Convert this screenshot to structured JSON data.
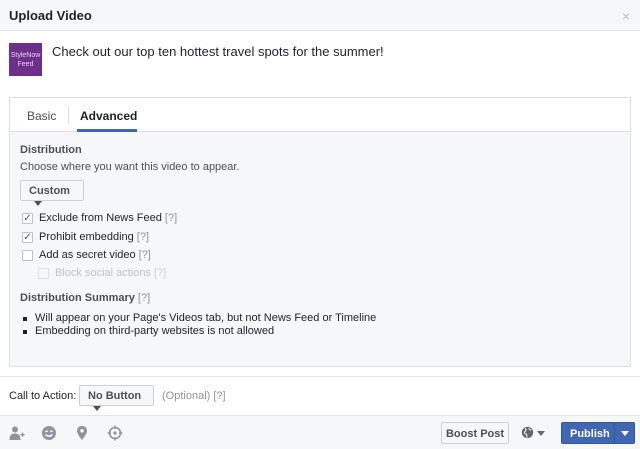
{
  "dialog": {
    "title": "Upload Video",
    "close_glyph": "×"
  },
  "post": {
    "avatar_text": "StyleNow Feed",
    "message": "Check out our top ten hottest travel spots for the summer!"
  },
  "tabs": [
    {
      "label": "Basic",
      "active": false
    },
    {
      "label": "Advanced",
      "active": true
    }
  ],
  "distribution": {
    "title": "Distribution",
    "description": "Choose where you want this video to appear.",
    "dropdown_value": "Custom",
    "options": [
      {
        "label": "Exclude from News Feed",
        "help": "[?]",
        "checked": true,
        "disabled": false
      },
      {
        "label": "Prohibit embedding",
        "help": "[?]",
        "checked": true,
        "disabled": false
      },
      {
        "label": "Add as secret video",
        "help": "[?]",
        "checked": false,
        "disabled": false
      },
      {
        "label": "Block social actions",
        "help": "[?]",
        "checked": false,
        "disabled": true
      }
    ]
  },
  "summary": {
    "title": "Distribution Summary",
    "help": "[?]",
    "items": [
      "Will appear on your Page's Videos tab, but not News Feed or Timeline",
      "Embedding on third-party websites is not allowed"
    ]
  },
  "call_to_action": {
    "label": "Call to Action:",
    "value": "No Button",
    "optional_text": "(Optional) [?]"
  },
  "footer": {
    "icons": [
      "tag-people-icon",
      "feeling-icon",
      "location-icon",
      "target-icon"
    ],
    "boost_label": "Boost Post",
    "audience_icon": "globe-icon",
    "publish_label": "Publish",
    "accent_color": "#4267b2"
  }
}
